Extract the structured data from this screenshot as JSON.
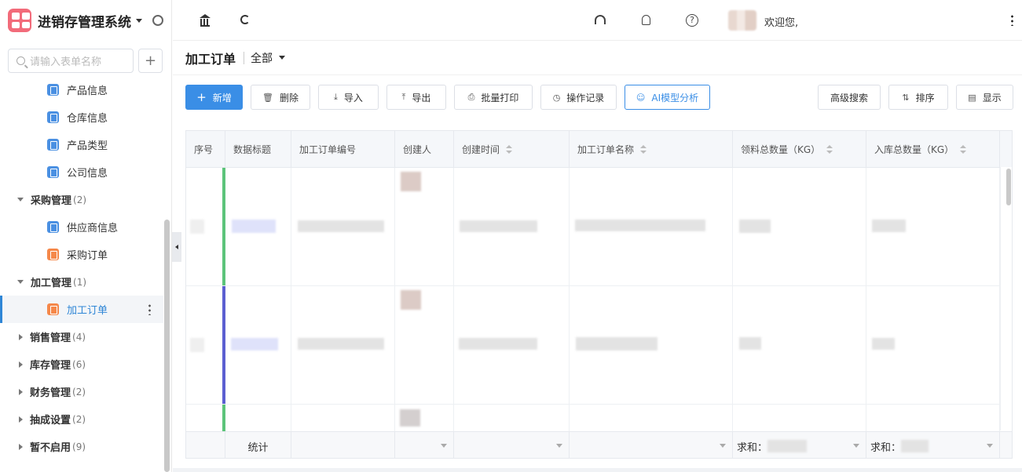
{
  "app": {
    "title": "进销存管理系统"
  },
  "sidebar": {
    "search_placeholder": "请输入表单名称",
    "add_label": "+",
    "items": [
      {
        "type": "leaf",
        "label": "产品信息",
        "color": "#4a90e2"
      },
      {
        "type": "leaf",
        "label": "仓库信息",
        "color": "#4a90e2"
      },
      {
        "type": "leaf",
        "label": "产品类型",
        "color": "#4a90e2"
      },
      {
        "type": "leaf",
        "label": "公司信息",
        "color": "#4a90e2"
      },
      {
        "type": "group",
        "label": "采购管理",
        "count": "(2)",
        "expanded": true
      },
      {
        "type": "leaf",
        "label": "供应商信息",
        "color": "#4a90e2"
      },
      {
        "type": "leaf",
        "label": "采购订单",
        "color": "#f5884a"
      },
      {
        "type": "group",
        "label": "加工管理",
        "count": "(1)",
        "expanded": true
      },
      {
        "type": "leaf",
        "label": "加工订单",
        "color": "#f5884a",
        "active": true
      },
      {
        "type": "group",
        "label": "销售管理",
        "count": "(4)",
        "expanded": false
      },
      {
        "type": "group",
        "label": "库存管理",
        "count": "(6)",
        "expanded": false
      },
      {
        "type": "group",
        "label": "财务管理",
        "count": "(2)",
        "expanded": false
      },
      {
        "type": "group",
        "label": "抽成设置",
        "count": "(2)",
        "expanded": false
      },
      {
        "type": "group",
        "label": "暂不启用",
        "count": "(9)",
        "expanded": false
      }
    ]
  },
  "topbar": {
    "welcome": "欢迎您,",
    "help_glyph": "?"
  },
  "page": {
    "title": "加工订单",
    "scope": "全部"
  },
  "toolbar": {
    "new": "新增",
    "delete": "删除",
    "import": "导入",
    "export": "导出",
    "batch_print": "批量打印",
    "history": "操作记录",
    "ai": "AI模型分析",
    "advanced_search": "高级搜索",
    "sort": "排序",
    "display": "显示"
  },
  "table": {
    "columns": [
      "序号",
      "数据标题",
      "加工订单编号",
      "创建人",
      "创建时间",
      "加工订单名称",
      "领料总数量（KG）",
      "入库总数量（KG）"
    ],
    "footer": {
      "label": "统计",
      "sum_prefix_1": "求和：",
      "sum_prefix_2": "求和："
    },
    "row_colors": [
      "#5cc47a",
      "#5b5fd1",
      "#5cc47a"
    ]
  }
}
